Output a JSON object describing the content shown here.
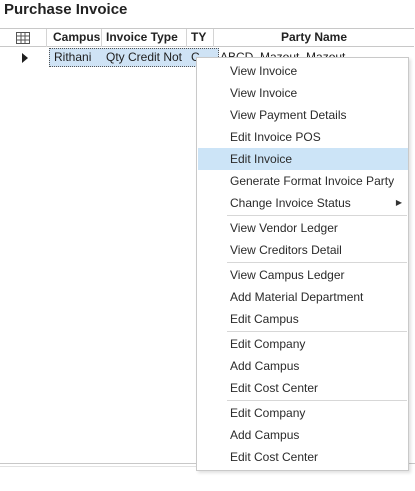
{
  "window": {
    "title": "Purchase Invoice"
  },
  "grid": {
    "columns": [
      "Campus",
      "Invoice Type",
      "TY",
      "Party Name"
    ],
    "rows": [
      {
        "campus": "Rithani",
        "invoice_type": "Qty Credit Not",
        "ty": "C",
        "party_name": "ABCD, Mazout, Mazout"
      }
    ]
  },
  "context_menu": {
    "items": [
      "View Invoice",
      "View Invoice",
      "View Payment Details",
      "Edit Invoice POS",
      "Edit Invoice",
      "Generate Format Invoice Party",
      "Change Invoice Status",
      "View Vendor Ledger",
      "View Creditors Detail",
      "View Campus Ledger",
      "Add Material Department",
      "Edit Campus",
      "Edit Company",
      "Add Campus",
      "Edit Cost Center",
      "Edit Company",
      "Add Campus",
      "Edit Cost Center"
    ],
    "highlighted": "Edit Invoice",
    "submenu_item": "Change Invoice Status"
  },
  "icons": {
    "column_chooser": "grid-icon",
    "row_indicator": "triangle-right-icon",
    "submenu": "triangle-right-icon"
  },
  "colors": {
    "selection": "#cfe3f5",
    "menu_highlight": "#cce4f7"
  }
}
